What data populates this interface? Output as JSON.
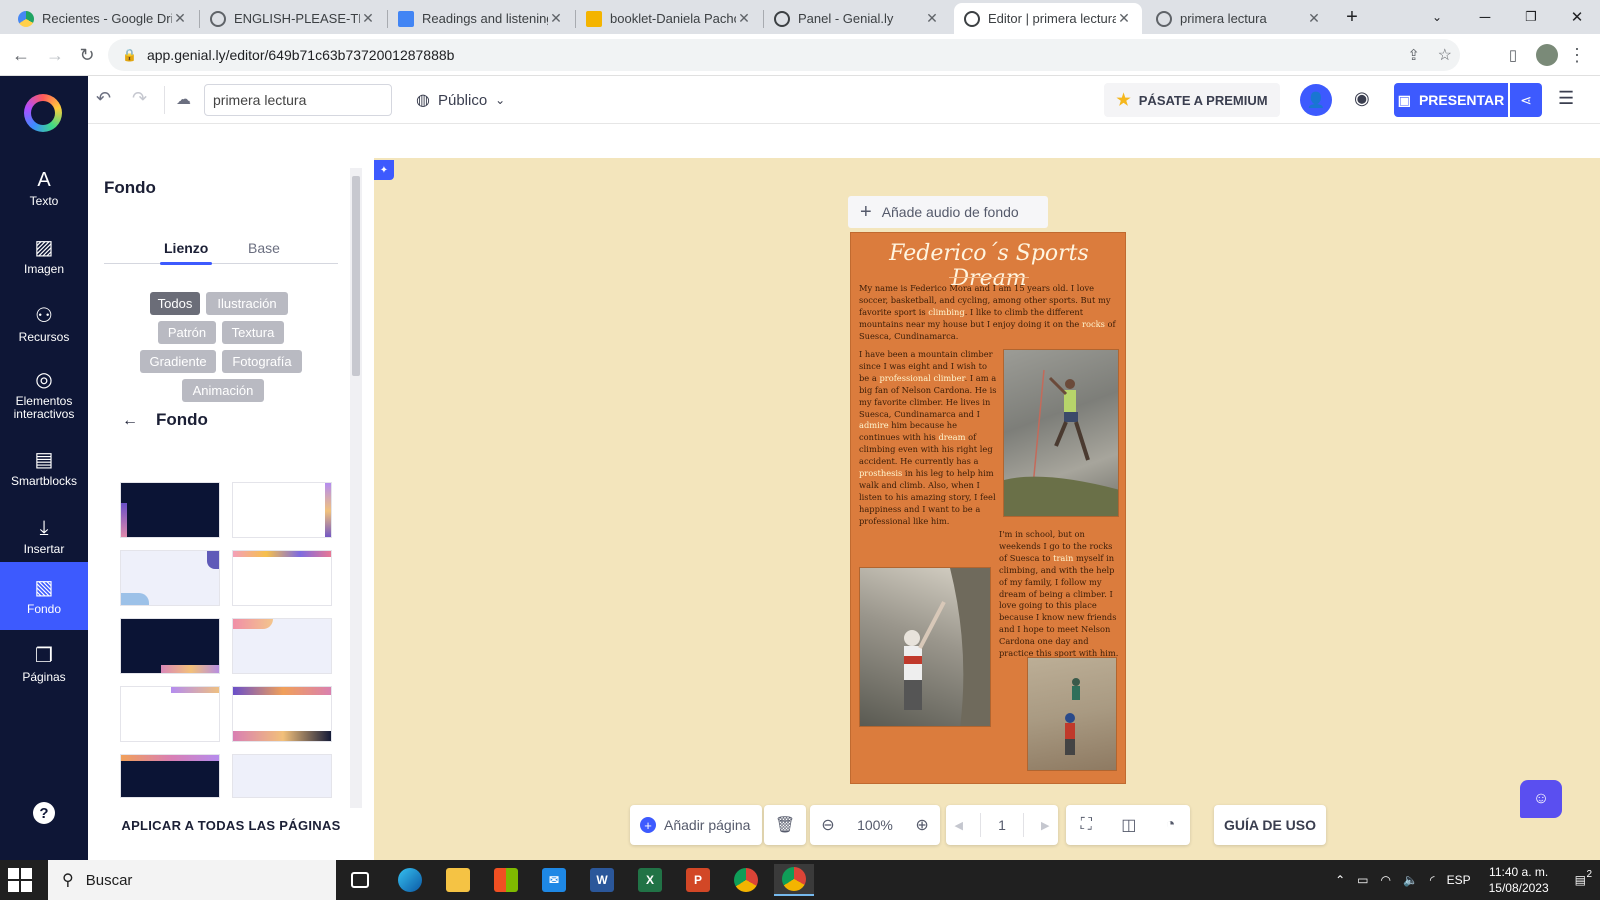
{
  "browser": {
    "tabs": [
      {
        "title": "Recientes - Google Drive",
        "favicon": "google-drive-icon",
        "active": false
      },
      {
        "title": "ENGLISH-PLEASE-TEACH",
        "favicon": "globe-icon",
        "active": false
      },
      {
        "title": "Readings and listening",
        "favicon": "google-docs-icon",
        "active": false
      },
      {
        "title": "booklet-Daniela Pachón",
        "favicon": "google-slides-icon",
        "active": false
      },
      {
        "title": "Panel - Genial.ly",
        "favicon": "genially-icon",
        "active": false
      },
      {
        "title": "Editor | primera lectura",
        "favicon": "genially-icon",
        "active": true
      },
      {
        "title": "primera lectura",
        "favicon": "globe-icon",
        "active": false
      }
    ],
    "url": "app.genial.ly/editor/649b71c63b7372001287888b"
  },
  "sidebar": {
    "items": [
      {
        "label": "Texto",
        "icon": "text-icon",
        "active": false
      },
      {
        "label": "Imagen",
        "icon": "image-icon",
        "active": false
      },
      {
        "label": "Recursos",
        "icon": "resources-icon",
        "active": false
      },
      {
        "label": "Elementos interactivos",
        "icon": "interactive-icon",
        "active": false
      },
      {
        "label": "Smartblocks",
        "icon": "smartblocks-icon",
        "active": false
      },
      {
        "label": "Insertar",
        "icon": "insert-icon",
        "active": false
      },
      {
        "label": "Fondo",
        "icon": "background-icon",
        "active": true
      },
      {
        "label": "Páginas",
        "icon": "pages-icon",
        "active": false
      }
    ],
    "help": "?"
  },
  "toolbar": {
    "title_value": "primera lectura",
    "visibility": "Público",
    "premium_label": "PÁSATE A PREMIUM",
    "present_label": "PRESENTAR"
  },
  "panel": {
    "title": "Fondo",
    "tabs": [
      "Lienzo",
      "Base"
    ],
    "active_tab": "Lienzo",
    "chips": [
      "Todos",
      "Ilustración",
      "Patrón",
      "Textura",
      "Gradiente",
      "Fotografía",
      "Animación"
    ],
    "active_chip": "Todos",
    "subsection_title": "Fondo",
    "apply_all_label": "APLICAR A TODAS LAS PÁGINAS"
  },
  "canvas": {
    "audio_label": "Añade audio de fondo",
    "page_background": "#db7c3d",
    "canvas_background": "#f3e5bc",
    "doc_title": "Federico´s Sports Dream",
    "paragraph1": [
      {
        "t": "My name is Federico Mora and I am 15 years old. I love soccer, basketball, and cycling, among other sports. But my favorite sport is "
      },
      {
        "t": "climbing",
        "hl": true
      },
      {
        "t": ". I like to climb the different mountains near my house but I enjoy doing it on the "
      },
      {
        "t": "rocks",
        "hl": true
      },
      {
        "t": " of Suesca, Cundinamarca."
      }
    ],
    "paragraph2": [
      {
        "t": "I have been a mountain climber since I was eight and I wish to be a "
      },
      {
        "t": "professional climber",
        "hl": true
      },
      {
        "t": ". I am a big fan of Nelson Cardona. He is my favorite climber. He lives in Suesca, Cundinamarca and I "
      },
      {
        "t": "admire",
        "hl": true
      },
      {
        "t": " him because he continues with his "
      },
      {
        "t": "dream",
        "hl": true
      },
      {
        "t": " of climbing even with his right leg accident. He currently has a "
      },
      {
        "t": "prosthesis",
        "hl": true
      },
      {
        "t": " in his leg to help him walk and climb. Also, when I listen to his amazing story, I feel happiness and I want to be a professional like him."
      }
    ],
    "paragraph3": [
      {
        "t": "I'm in school, but on weekends I go to the rocks of Suesca to "
      },
      {
        "t": "train",
        "hl": true
      },
      {
        "t": " myself in climbing, and with the help of my family, I follow my dream of being a climber. I love going to this place because I know new friends and I hope to meet Nelson Cardona one day and practice this sport with him."
      }
    ]
  },
  "bottombar": {
    "add_page_label": "Añadir página",
    "zoom": "100%",
    "page_number": "1",
    "guide_label": "GUÍA DE USO"
  },
  "taskbar": {
    "search_placeholder": "Buscar",
    "language": "ESP",
    "time": "11:40 a. m.",
    "date": "15/08/2023",
    "notifications": "2"
  }
}
